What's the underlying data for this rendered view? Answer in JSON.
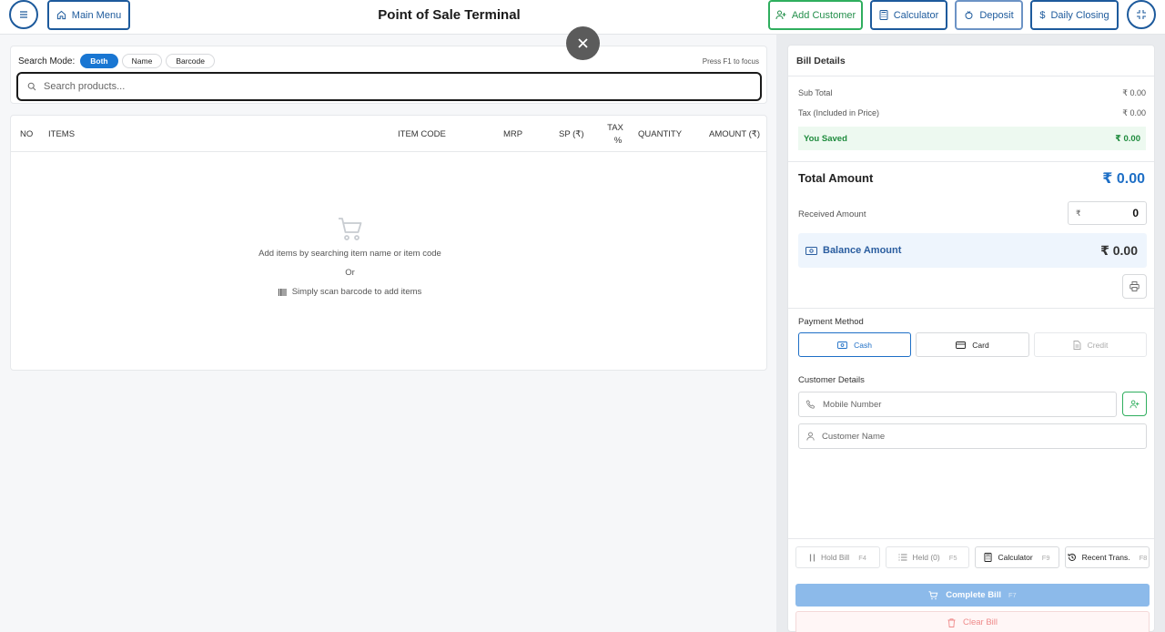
{
  "header": {
    "title": "Point of Sale Terminal",
    "main_menu": "Main Menu",
    "add_customer": "Add Customer",
    "calculator": "Calculator",
    "deposit": "Deposit",
    "daily_closing": "Daily Closing"
  },
  "search": {
    "mode_label": "Search Mode:",
    "modes": [
      "Both",
      "Name",
      "Barcode"
    ],
    "active_mode": "Both",
    "hint": "Press F1 to focus",
    "placeholder": "Search products...",
    "value": ""
  },
  "table": {
    "columns": [
      "NO",
      "ITEMS",
      "ITEM CODE",
      "MRP",
      "SP (₹)",
      "TAX",
      "%",
      "QUANTITY",
      "AMOUNT (₹)"
    ],
    "rows": [],
    "empty_line1": "Add items by searching item name or item code",
    "empty_or": "Or",
    "empty_line2": "Simply scan barcode to add items"
  },
  "bill": {
    "title": "Bill Details",
    "sub_total_label": "Sub Total",
    "sub_total": "₹ 0.00",
    "tax_label": "Tax (Included in Price)",
    "tax": "₹ 0.00",
    "saved_label": "You Saved",
    "saved": "₹ 0.00",
    "total_label": "Total Amount",
    "total": "₹ 0.00",
    "received_label": "Received Amount",
    "currency_symbol": "₹",
    "received": "0",
    "balance_label": "Balance Amount",
    "balance": "₹ 0.00"
  },
  "payment": {
    "label": "Payment Method",
    "methods": [
      "Cash",
      "Card",
      "Credit"
    ],
    "selected": "Cash"
  },
  "customer": {
    "label": "Customer Details",
    "mobile_placeholder": "Mobile Number",
    "name_placeholder": "Customer Name"
  },
  "actions": {
    "hold_bill": "Hold Bill",
    "hold_key": "F4",
    "held": "Held (0)",
    "held_key": "F5",
    "calculator": "Calculator",
    "calculator_key": "F9",
    "recent": "Recent Trans.",
    "recent_key": "F8",
    "complete": "Complete Bill",
    "complete_key": "F7",
    "clear": "Clear Bill"
  },
  "colors": {
    "primary": "#1d5a9c",
    "accent_blue": "#1976d2",
    "success": "#2fae5e",
    "danger": "#ef8a8a"
  }
}
